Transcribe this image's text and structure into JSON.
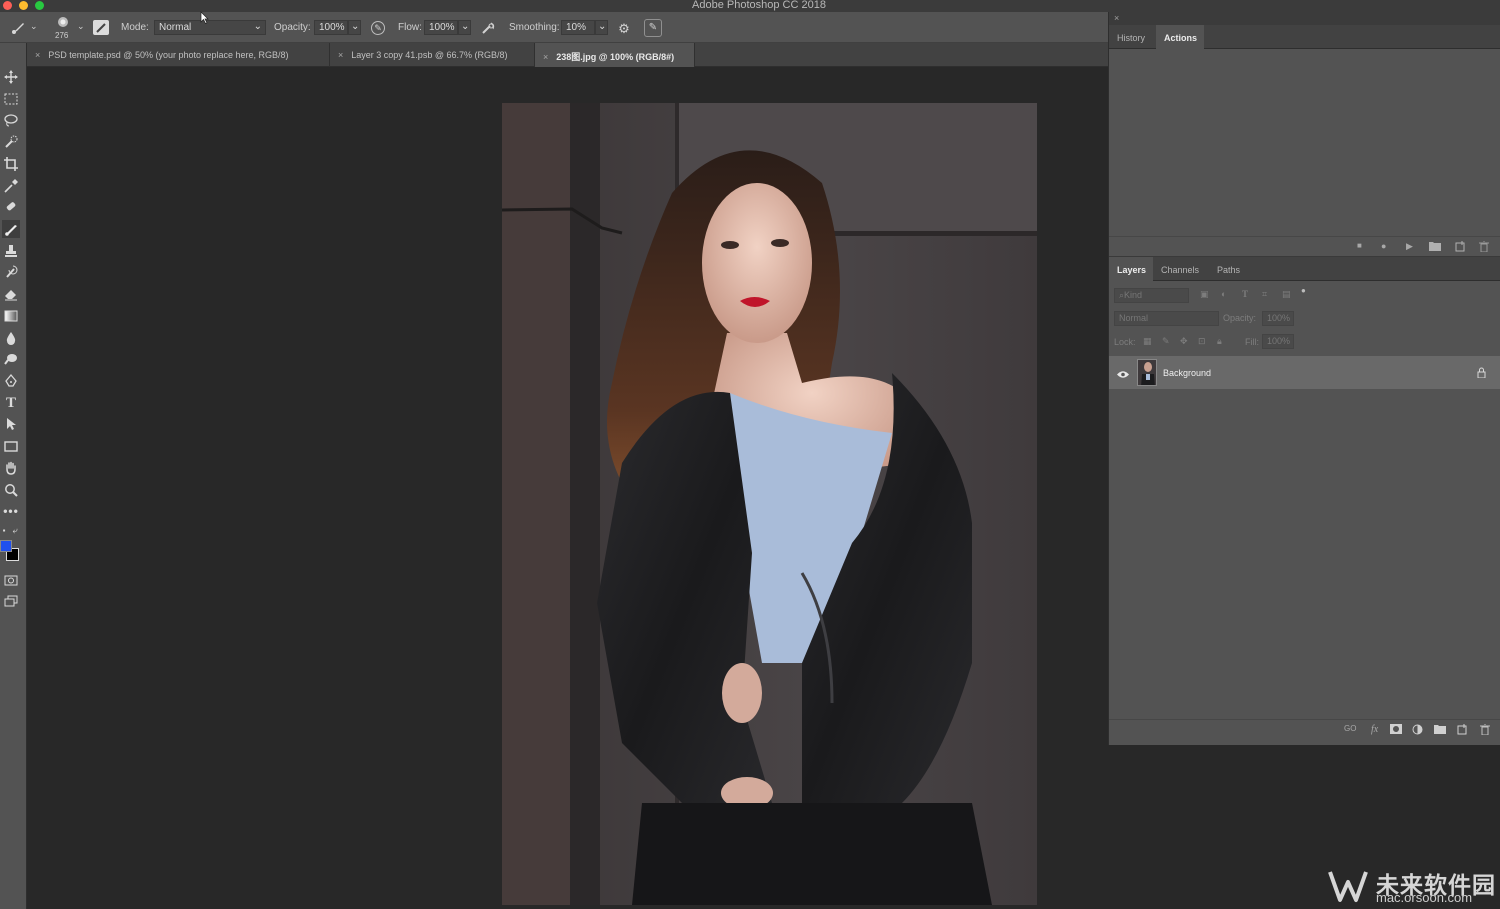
{
  "window": {
    "title": "Adobe Photoshop CC 2018"
  },
  "options_bar": {
    "brush_size": "276",
    "mode_label": "Mode:",
    "mode_value": "Normal",
    "opacity_label": "Opacity:",
    "opacity_value": "100%",
    "flow_label": "Flow:",
    "flow_value": "100%",
    "smoothing_label": "Smoothing:",
    "smoothing_value": "10%"
  },
  "document_tabs": [
    {
      "label": "PSD template.psd @ 50% (your photo replace here, RGB/8)"
    },
    {
      "label": "Layer 3 copy 41.psb @ 66.7% (RGB/8)"
    },
    {
      "label": "238图.jpg @ 100% (RGB/8#)"
    }
  ],
  "tools": [
    "move-icon",
    "marquee-icon",
    "lasso-icon",
    "quick-selection-icon",
    "crop-icon",
    "eyedropper-icon",
    "healing-brush-icon",
    "brush-icon",
    "clone-stamp-icon",
    "history-brush-icon",
    "eraser-icon",
    "gradient-icon",
    "blur-icon",
    "dodge-icon",
    "pen-icon",
    "type-icon",
    "path-selection-icon",
    "rectangle-icon",
    "hand-icon",
    "zoom-icon",
    "more-tools-icon"
  ],
  "colors": {
    "foreground": "#2050ee",
    "background": "#000000"
  },
  "history_panel": {
    "tabs": [
      {
        "label": "History"
      },
      {
        "label": "Actions"
      }
    ]
  },
  "layers_panel": {
    "tabs": [
      {
        "label": "Layers"
      },
      {
        "label": "Channels"
      },
      {
        "label": "Paths"
      }
    ],
    "filter_placeholder": "Kind",
    "blend_mode": "Normal",
    "opacity_label": "Opacity:",
    "opacity_value": "100%",
    "lock_label": "Lock:",
    "fill_label": "Fill:",
    "fill_value": "100%",
    "layers": [
      {
        "name": "Background"
      }
    ],
    "footer_link": "GO",
    "footer_fx": "fx"
  },
  "watermark": {
    "main": "未来软件园",
    "sub": "mac.orsoon.com"
  }
}
